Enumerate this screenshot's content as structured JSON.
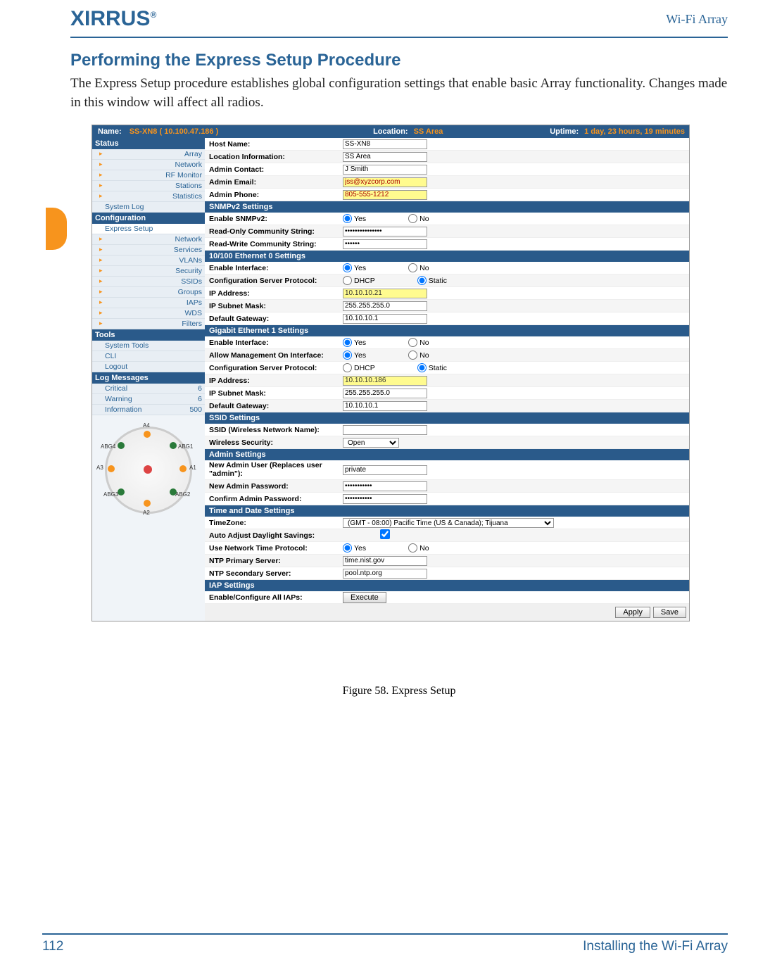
{
  "header": {
    "logo": "XIRRUS",
    "doc_title": "Wi-Fi Array"
  },
  "section_title": "Performing the Express Setup Procedure",
  "body_text": "The Express Setup procedure establishes global configuration settings that enable basic Array functionality. Changes made in this window will affect all radios.",
  "topbar": {
    "name_label": "Name:",
    "name_value": "SS-XN8   ( 10.100.47.186 )",
    "location_label": "Location:",
    "location_value": "SS Area",
    "uptime_label": "Uptime:",
    "uptime_value": "1 day, 23 hours, 19 minutes"
  },
  "sidebar": {
    "sections": {
      "status": {
        "title": "Status",
        "items": [
          "Array",
          "Network",
          "RF Monitor",
          "Stations",
          "Statistics",
          "System Log"
        ]
      },
      "config": {
        "title": "Configuration",
        "items": [
          "Express Setup",
          "Network",
          "Services",
          "VLANs",
          "Security",
          "SSIDs",
          "Groups",
          "IAPs",
          "WDS",
          "Filters"
        ]
      },
      "tools": {
        "title": "Tools",
        "items": [
          "System Tools",
          "CLI",
          "Logout"
        ]
      },
      "log": {
        "title": "Log Messages",
        "items": [
          {
            "label": "Critical",
            "count": "6"
          },
          {
            "label": "Warning",
            "count": "6"
          },
          {
            "label": "Information",
            "count": "500"
          }
        ]
      }
    },
    "diagram_labels": [
      "A4",
      "ABG4",
      "ABG1",
      "A3",
      "A1",
      "ABG3",
      "ABG2",
      "A2"
    ]
  },
  "main": {
    "rows_basic": [
      {
        "label": "Host Name:",
        "value": "SS-XN8"
      },
      {
        "label": "Location Information:",
        "value": "SS Area"
      },
      {
        "label": "Admin Contact:",
        "value": "J Smith"
      },
      {
        "label": "Admin Email:",
        "value": "jss@xyzcorp.com",
        "hl": true
      },
      {
        "label": "Admin Phone:",
        "value": "805-555-1212",
        "hl": true
      }
    ],
    "snmp": {
      "title": "SNMPv2 Settings",
      "enable": "Enable SNMPv2:",
      "ro": {
        "label": "Read-Only Community String:",
        "value": "•••••••••••••••"
      },
      "rw": {
        "label": "Read-Write Community String:",
        "value": "••••••"
      }
    },
    "eth0": {
      "title": "10/100 Ethernet 0 Settings",
      "enable": "Enable Interface:",
      "proto": "Configuration Server Protocol:",
      "ip": {
        "label": "IP Address:",
        "value": "10.10.10.21"
      },
      "mask": {
        "label": "IP Subnet Mask:",
        "value": "255.255.255.0"
      },
      "gw": {
        "label": "Default Gateway:",
        "value": "10.10.10.1"
      }
    },
    "gig1": {
      "title": "Gigabit Ethernet 1 Settings",
      "enable": "Enable Interface:",
      "mgmt": "Allow Management On Interface:",
      "proto": "Configuration Server Protocol:",
      "ip": {
        "label": "IP Address:",
        "value": "10.10.10.186"
      },
      "mask": {
        "label": "IP Subnet Mask:",
        "value": "255.255.255.0"
      },
      "gw": {
        "label": "Default Gateway:",
        "value": "10.10.10.1"
      }
    },
    "ssid": {
      "title": "SSID Settings",
      "name": {
        "label": "SSID (Wireless Network Name):",
        "value": ""
      },
      "sec": {
        "label": "Wireless Security:",
        "value": "Open"
      }
    },
    "admin": {
      "title": "Admin Settings",
      "user": {
        "label": "New Admin User (Replaces user \"admin\"):",
        "value": "private"
      },
      "pass": {
        "label": "New Admin Password:",
        "value": "•••••••••••"
      },
      "conf": {
        "label": "Confirm Admin Password:",
        "value": "•••••••••••"
      }
    },
    "time": {
      "title": "Time and Date Settings",
      "tz": {
        "label": "TimeZone:",
        "value": "(GMT - 08:00) Pacific Time (US & Canada); Tijuana"
      },
      "dst": "Auto Adjust Daylight Savings:",
      "ntp": "Use Network Time Protocol:",
      "ntp1": {
        "label": "NTP Primary Server:",
        "value": "time.nist.gov"
      },
      "ntp2": {
        "label": "NTP Secondary Server:",
        "value": "pool.ntp.org"
      }
    },
    "iap": {
      "title": "IAP Settings",
      "exec": {
        "label": "Enable/Configure All IAPs:",
        "btn": "Execute"
      }
    },
    "yes": "Yes",
    "no": "No",
    "dhcp": "DHCP",
    "static": "Static",
    "apply": "Apply",
    "save": "Save"
  },
  "caption": "Figure 58. Express Setup",
  "footer": {
    "page_num": "112",
    "title": "Installing the Wi-Fi Array"
  }
}
